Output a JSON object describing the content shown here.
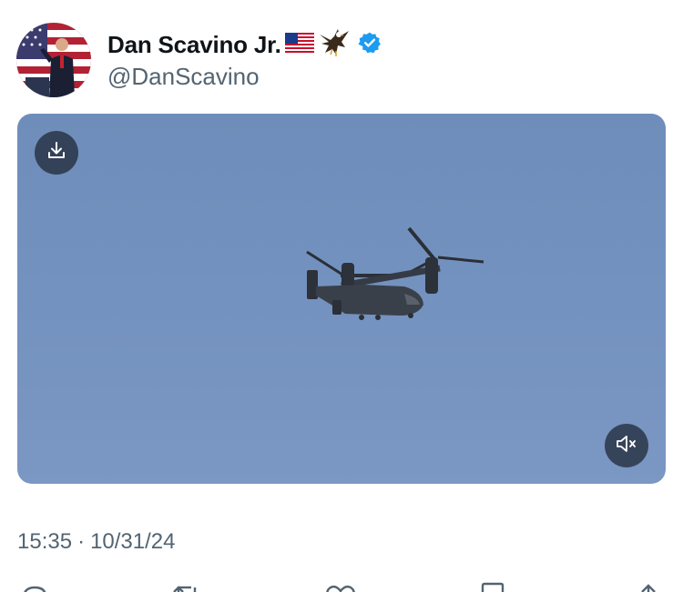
{
  "author": {
    "display_name": "Dan Scavino Jr.",
    "handle": "@DanScavino",
    "name_emojis": [
      "us-flag",
      "eagle"
    ],
    "verified": true,
    "verified_color": "#1d9bf0"
  },
  "media": {
    "type": "video",
    "sky_color": "#7492bf"
  },
  "meta": {
    "time": "15:35",
    "separator": "·",
    "date": "10/31/24"
  },
  "actions": [
    "reply",
    "repost",
    "like",
    "bookmark",
    "share"
  ]
}
